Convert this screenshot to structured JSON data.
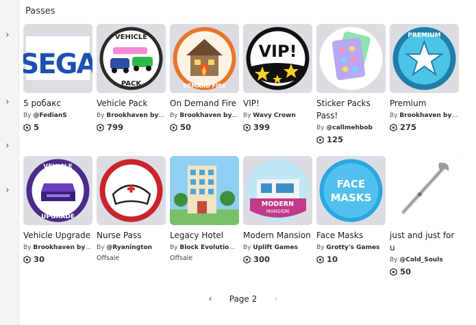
{
  "section": {
    "title": "Passes"
  },
  "pager": {
    "label": "Page 2"
  },
  "rail": {
    "chevron_count": 4
  },
  "colors": {
    "accent": "#2e8bd8",
    "thumb_bg": "#dcdde3"
  },
  "passes": [
    {
      "name": "5 робакс",
      "by": "By",
      "creator": "@FedianS",
      "price": "5",
      "offsale_text": "",
      "icon": "sega-logo"
    },
    {
      "name": "Vehicle Pack",
      "by": "By",
      "creator": "Brookhaven by V...",
      "price": "799",
      "offsale_text": "",
      "icon": "vehicle-pack-badge"
    },
    {
      "name": "On Demand Fire",
      "by": "By",
      "creator": "Brookhaven by V...",
      "price": "50",
      "offsale_text": "",
      "icon": "burning-house-badge"
    },
    {
      "name": "VIP!",
      "by": "By",
      "creator": "Wavy Crown",
      "price": "399",
      "offsale_text": "",
      "icon": "vip-stars-badge"
    },
    {
      "name": "Sticker Packs Pass!",
      "by": "By",
      "creator": "@callmehbob",
      "price": "125",
      "offsale_text": "",
      "icon": "sticker-cards-badge"
    },
    {
      "name": "Premium",
      "by": "By",
      "creator": "Brookhaven by V...",
      "price": "275",
      "offsale_text": "",
      "icon": "premium-star-badge"
    },
    {
      "name": "Vehicle Upgrade",
      "by": "By",
      "creator": "Brookhaven by V...",
      "price": "30",
      "offsale_text": "",
      "icon": "vehicle-upgrade-badge"
    },
    {
      "name": "Nurse Pass",
      "by": "By",
      "creator": "@Ryanington",
      "price": "",
      "offsale_text": "Offsale",
      "icon": "nurse-hat-badge"
    },
    {
      "name": "Legacy Hotel",
      "by": "By",
      "creator": "Block Evolution S...",
      "price": "",
      "offsale_text": "Offsale",
      "icon": "hotel-building"
    },
    {
      "name": "Modern Mansion",
      "by": "By",
      "creator": "Uplift Games",
      "price": "300",
      "offsale_text": "",
      "icon": "modern-mansion-badge"
    },
    {
      "name": "Face Masks",
      "by": "By",
      "creator": "Grotty's Games",
      "price": "10",
      "offsale_text": "",
      "icon": "face-masks-badge"
    },
    {
      "name": "just and just for u",
      "by": "By",
      "creator": "@Cold_Souls",
      "price": "50",
      "offsale_text": "",
      "icon": "silver-staff"
    }
  ]
}
